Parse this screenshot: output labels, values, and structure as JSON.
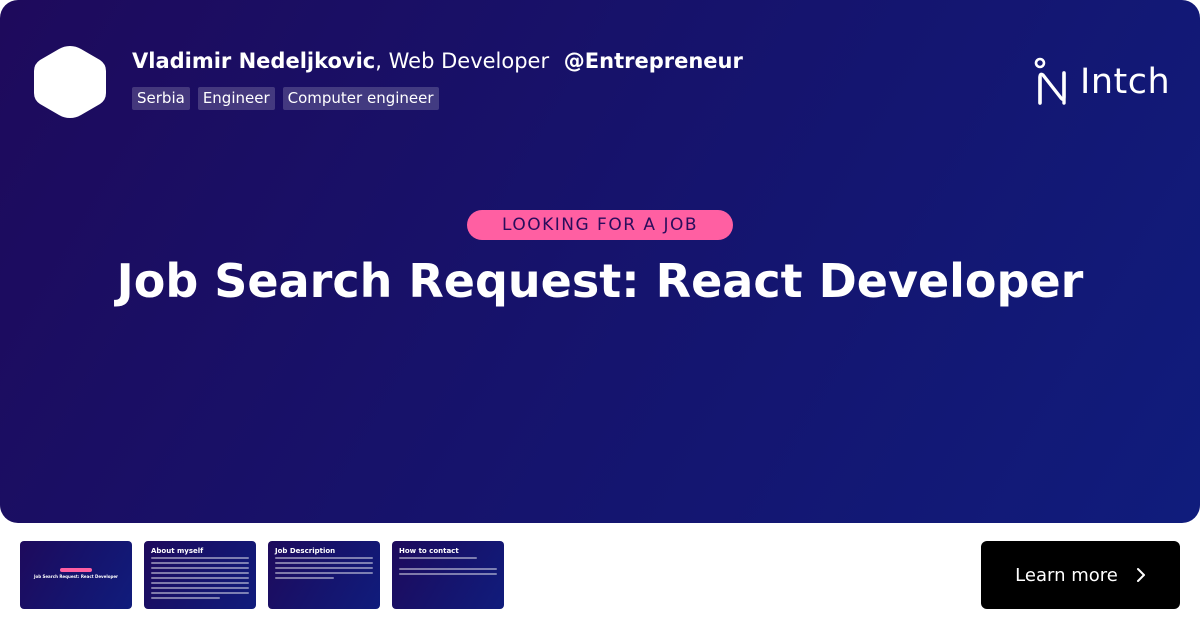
{
  "profile": {
    "name": "Vladimir Nedeljkovic",
    "separator": ",",
    "role": "Web Developer",
    "handle": "@Entrepreneur",
    "tags": [
      "Serbia",
      "Engineer",
      "Computer engineer"
    ]
  },
  "brand": {
    "name": "Intch",
    "icon": "intch-logo-icon"
  },
  "post": {
    "badge": "LOOKING FOR A JOB",
    "title": "Job Search Request: React Developer"
  },
  "thumbnails": [
    {
      "heading": "",
      "caption": "Job Search Request: React Developer"
    },
    {
      "heading": "About myself"
    },
    {
      "heading": "Job Description"
    },
    {
      "heading": "How to contact"
    }
  ],
  "cta": {
    "label": "Learn more",
    "icon": "chevron-right-icon"
  },
  "colors": {
    "card_start": "#1e0a5c",
    "card_end": "#101c7c",
    "badge_bg": "#ff5fa2",
    "badge_text": "#2a0d5c",
    "tag_bg": "rgba(255,255,255,0.18)",
    "button_bg": "#000000"
  }
}
